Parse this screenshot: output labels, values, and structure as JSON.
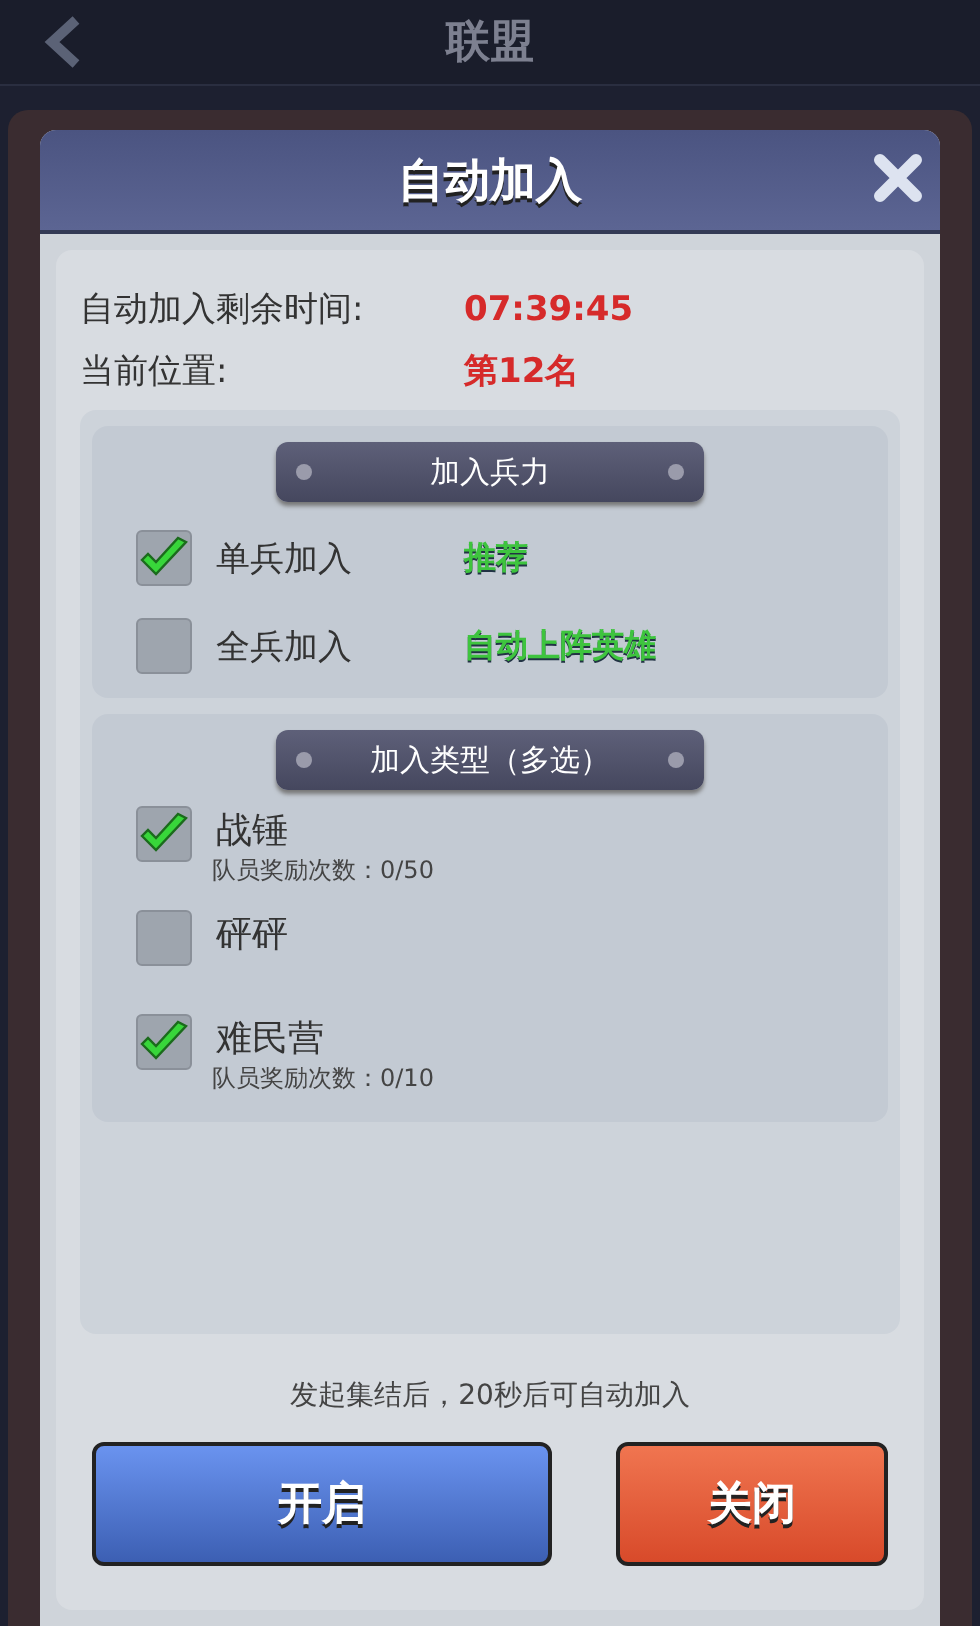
{
  "top_bar": {
    "title": "联盟"
  },
  "dialog": {
    "title": "自动加入",
    "info": [
      {
        "label": "自动加入剩余时间:",
        "value": "07:39:45"
      },
      {
        "label": "当前位置:",
        "value": "第12名"
      }
    ],
    "sections": [
      {
        "heading": "加入兵力",
        "kind": "inline",
        "options": [
          {
            "label": "单兵加入",
            "note": "推荐",
            "checked": true
          },
          {
            "label": "全兵加入",
            "note": "自动上阵英雄",
            "checked": false
          }
        ]
      },
      {
        "heading": "加入类型（多选）",
        "kind": "stacked",
        "options": [
          {
            "label": "战锤",
            "sub": "队员奖励次数：0/50",
            "checked": true
          },
          {
            "label": "砰砰",
            "checked": false
          },
          {
            "label": "难民营",
            "sub": "队员奖励次数：0/10",
            "checked": true
          }
        ]
      }
    ],
    "hint": "发起集结后，20秒后可自动加入",
    "buttons": [
      {
        "label": "开启",
        "kind": "primary"
      },
      {
        "label": "关闭",
        "kind": "danger"
      }
    ]
  }
}
